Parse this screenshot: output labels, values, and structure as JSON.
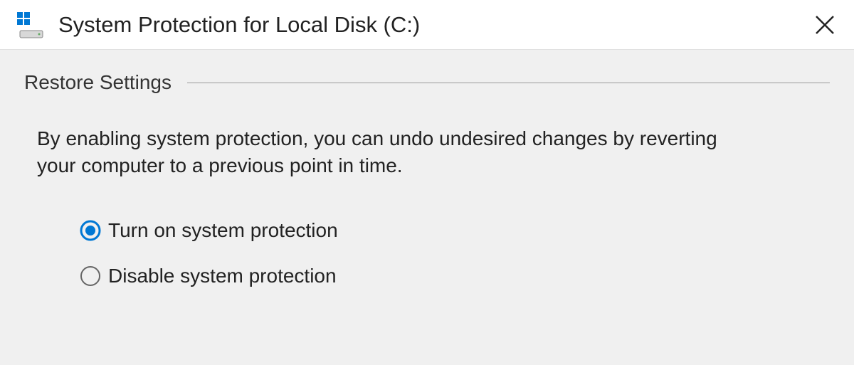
{
  "titlebar": {
    "title": "System Protection for Local Disk (C:)"
  },
  "group": {
    "heading": "Restore Settings",
    "description": "By enabling system protection, you can undo undesired changes by reverting your computer to a previous point in time."
  },
  "options": {
    "turn_on": {
      "label": "Turn on system protection",
      "selected": true
    },
    "disable": {
      "label": "Disable system protection",
      "selected": false
    }
  }
}
